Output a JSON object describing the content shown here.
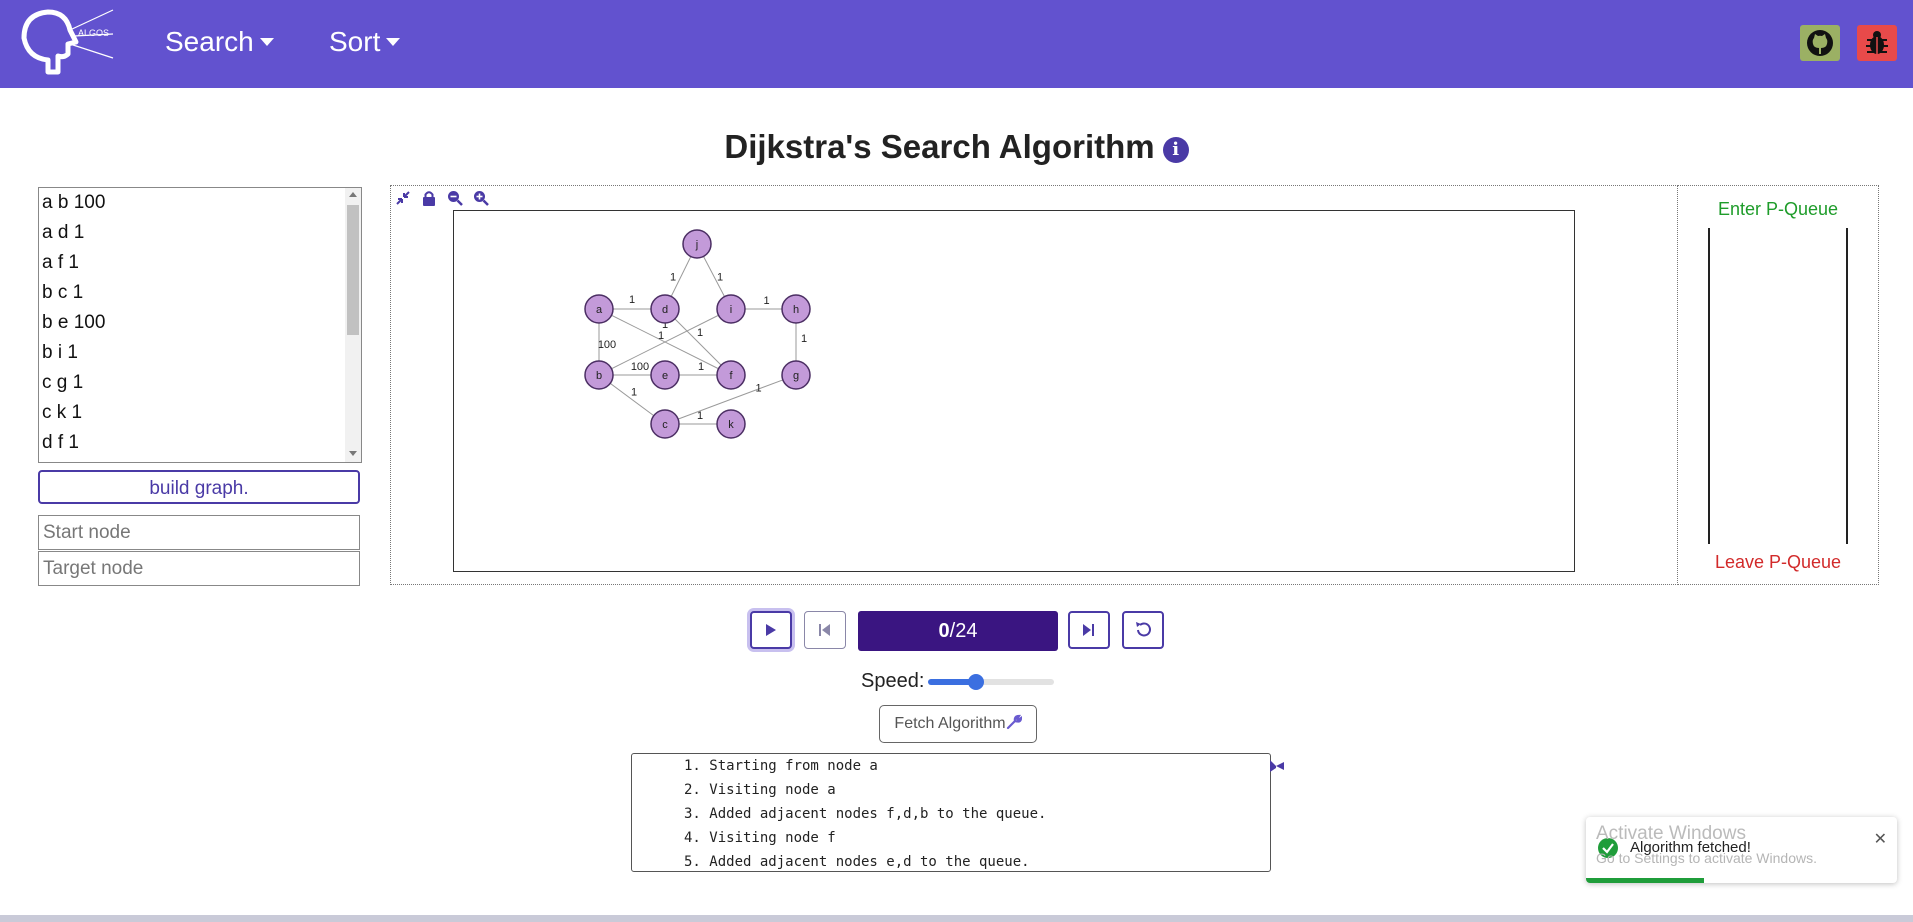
{
  "navbar": {
    "logo_text": "ALGOS",
    "menu": [
      {
        "label": "Search"
      },
      {
        "label": "Sort"
      }
    ],
    "colors": {
      "navbar": "#6252cf",
      "github_button": "#9bb064",
      "bug_button": "#e84a4a"
    },
    "icons": {
      "github": "github-icon",
      "bug": "bug-icon"
    }
  },
  "page": {
    "title": "Dijkstra's Search Algorithm",
    "info_icon": "i"
  },
  "input_panel": {
    "edges": [
      "a b 100",
      "a d 1",
      "a f 1",
      "b c 1",
      "b e 100",
      "b i 1",
      "c g 1",
      "c k 1",
      "d f 1"
    ],
    "build_button": "build graph.",
    "start_placeholder": "Start node",
    "target_placeholder": "Target node"
  },
  "graph": {
    "toolbar_icons": [
      "fit-icon",
      "lock-icon",
      "zoom-out-icon",
      "zoom-in-icon"
    ],
    "nodes": [
      "j",
      "a",
      "d",
      "i",
      "h",
      "b",
      "e",
      "f",
      "g",
      "c",
      "k"
    ],
    "edges": [
      {
        "from": "a",
        "to": "d",
        "label": "1"
      },
      {
        "from": "d",
        "to": "j",
        "label": "1"
      },
      {
        "from": "j",
        "to": "i",
        "label": "1"
      },
      {
        "from": "i",
        "to": "h",
        "label": "1"
      },
      {
        "from": "h",
        "to": "g",
        "label": "1"
      },
      {
        "from": "a",
        "to": "b",
        "label": "100"
      },
      {
        "from": "b",
        "to": "e",
        "label": "100"
      },
      {
        "from": "e",
        "to": "f",
        "label": "1"
      },
      {
        "from": "a",
        "to": "f",
        "label": "1"
      },
      {
        "from": "b",
        "to": "i",
        "label": "1"
      },
      {
        "from": "d",
        "to": "f",
        "label": "1"
      },
      {
        "from": "b",
        "to": "c",
        "label": "1"
      },
      {
        "from": "c",
        "to": "k",
        "label": "1"
      },
      {
        "from": "c",
        "to": "g",
        "label": "1"
      }
    ],
    "node_color": "#c39ad9"
  },
  "queue": {
    "enter_label": "Enter P-Queue",
    "leave_label": "Leave P-Queue"
  },
  "controls": {
    "step_current": "0",
    "step_total": "/24",
    "speed_label": "Speed:",
    "speed_value": 0.38,
    "fetch_label": "Fetch Algorithm",
    "icons": {
      "play": "play-icon",
      "prev": "step-back-icon",
      "next": "step-forward-icon",
      "reset": "reset-icon",
      "fetch": "wrench-icon"
    }
  },
  "log": {
    "lines": [
      "1. Starting from node a",
      "2. Visiting node a",
      "3. Added adjacent nodes f,d,b to the queue.",
      "4. Visiting node f",
      "5. Added adjacent nodes e,d to the queue."
    ]
  },
  "toast": {
    "message": "Algorithm fetched!",
    "progress": 0.38
  },
  "watermark": {
    "title": "Activate Windows",
    "subtitle": "Go to Settings to activate Windows."
  }
}
